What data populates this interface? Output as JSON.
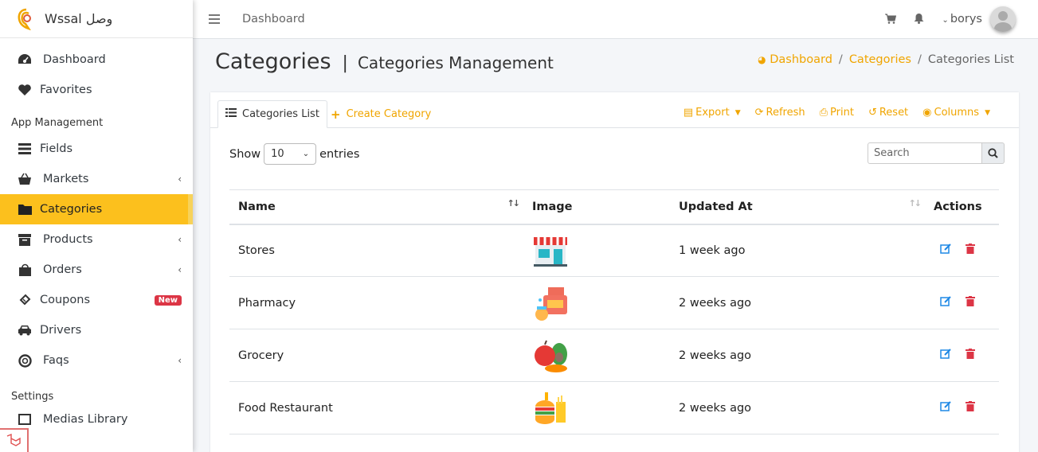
{
  "brand": {
    "name": "Wssal وصل"
  },
  "sidebar": {
    "items": [
      {
        "label": "Dashboard"
      },
      {
        "label": "Favorites"
      }
    ],
    "section_app": "App Management",
    "app_items": [
      {
        "label": "Fields"
      },
      {
        "label": "Markets"
      },
      {
        "label": "Categories"
      },
      {
        "label": "Products"
      },
      {
        "label": "Orders"
      },
      {
        "label": "Coupons",
        "badge": "New"
      },
      {
        "label": "Drivers"
      },
      {
        "label": "Faqs"
      }
    ],
    "section_settings": "Settings",
    "settings_items": [
      {
        "label": "Medias Library"
      }
    ]
  },
  "topbar": {
    "title": "Dashboard",
    "user": "borys"
  },
  "page": {
    "title": "Categories",
    "separator": "|",
    "subtitle": "Categories Management"
  },
  "breadcrumb": {
    "home": "Dashboard",
    "section": "Categories",
    "current": "Categories List",
    "divider": "/"
  },
  "card": {
    "tab_list": "Categories List",
    "tab_create": "Create Category",
    "tools": {
      "export": "Export",
      "refresh": "Refresh",
      "print": "Print",
      "reset": "Reset",
      "columns": "Columns"
    },
    "show_label": "Show",
    "entries_value": "10",
    "entries_label": "entries",
    "search_placeholder": "Search"
  },
  "table": {
    "headers": {
      "name": "Name",
      "image": "Image",
      "updated": "Updated At",
      "actions": "Actions"
    },
    "rows": [
      {
        "name": "Stores",
        "updated": "1 week ago"
      },
      {
        "name": "Pharmacy",
        "updated": "2 weeks ago"
      },
      {
        "name": "Grocery",
        "updated": "2 weeks ago"
      },
      {
        "name": "Food Restaurant",
        "updated": "2 weeks ago"
      }
    ]
  },
  "colors": {
    "accent": "#fcc01d",
    "link": "#f0a500",
    "edit": "#1e88e5",
    "delete": "#dc3545"
  }
}
